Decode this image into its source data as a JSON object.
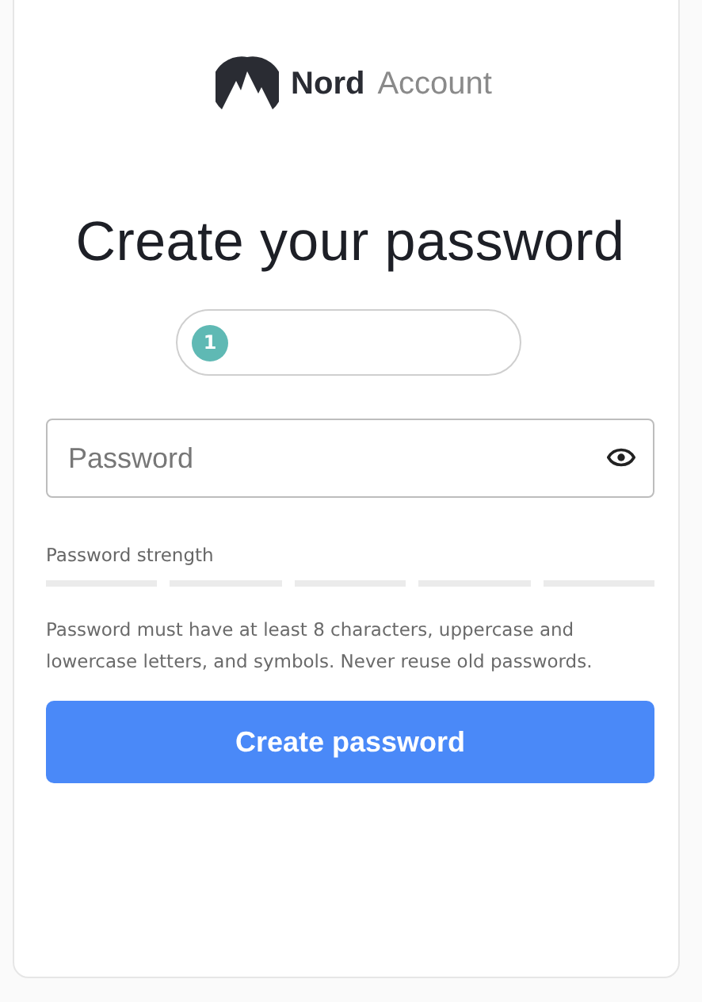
{
  "logo": {
    "brand": "Nord",
    "product": "Account"
  },
  "heading": "Create your password",
  "account_pill": {
    "badge": "1"
  },
  "password_field": {
    "placeholder": "Password"
  },
  "strength": {
    "label": "Password strength",
    "segments": [
      {
        "filled": false
      },
      {
        "filled": false
      },
      {
        "filled": false
      },
      {
        "filled": false
      },
      {
        "filled": false
      }
    ]
  },
  "hint": "Password must have at least 8 characters, uppercase and lowercase letters, and symbols. Never reuse old passwords.",
  "submit_button": "Create password"
}
